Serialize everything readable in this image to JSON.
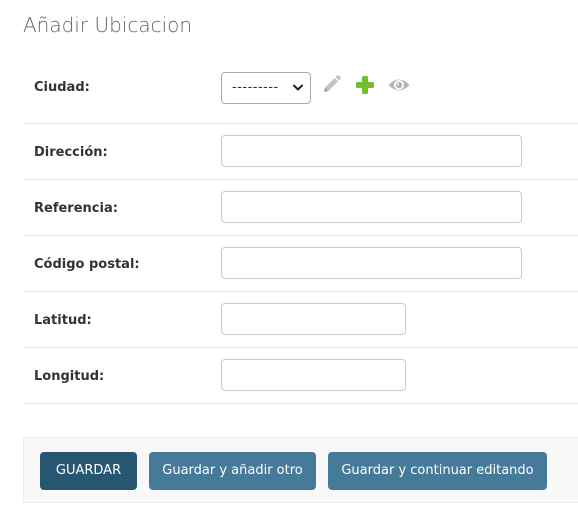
{
  "page": {
    "title": "Añadir Ubicacion"
  },
  "form": {
    "ciudad": {
      "label": "Ciudad:",
      "selected_value": "---------",
      "icons": [
        "pencil-icon",
        "plus-icon",
        "eye-icon"
      ]
    },
    "direccion": {
      "label": "Dirección:",
      "value": ""
    },
    "referencia": {
      "label": "Referencia:",
      "value": ""
    },
    "codigo_postal": {
      "label": "Código postal:",
      "value": ""
    },
    "latitud": {
      "label": "Latitud:",
      "value": ""
    },
    "longitud": {
      "label": "Longitud:",
      "value": ""
    }
  },
  "actions": {
    "save_label": "GUARDAR",
    "save_add_label": "Guardar y añadir otro",
    "save_continue_label": "Guardar y continuar editando"
  },
  "colors": {
    "primary_button": "#265672",
    "secondary_button": "#457a99",
    "add_icon": "#70bf2b",
    "muted_icon": "#bbbbbb"
  }
}
